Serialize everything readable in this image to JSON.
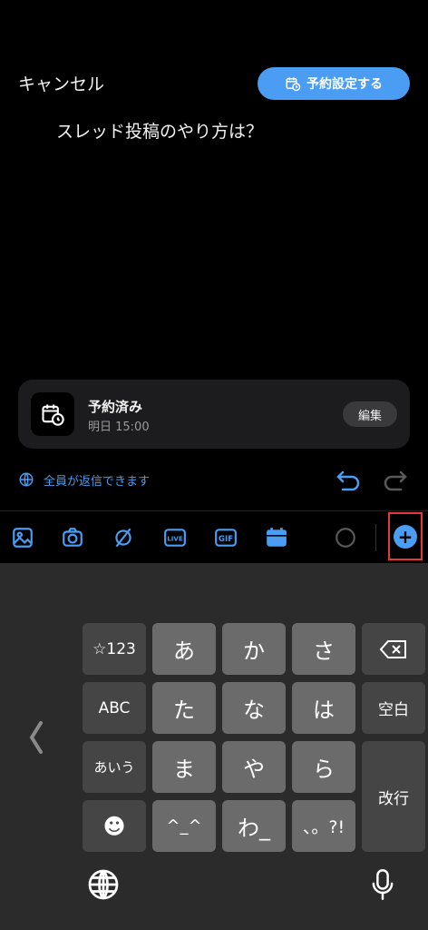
{
  "header": {
    "cancel_label": "キャンセル",
    "schedule_button_label": "予約設定する"
  },
  "post": {
    "text": "スレッド投稿のやり方は？"
  },
  "schedule_card": {
    "title": "予約済み",
    "time": "明日 15:00",
    "edit_label": "編集"
  },
  "reply_setting": {
    "label": "全員が返信できます"
  },
  "toolbar": {
    "icons": [
      "image-icon",
      "camera-icon",
      "no-sign-icon",
      "live-icon",
      "gif-icon",
      "calendar-icon",
      "progress-ring-icon",
      "add-icon"
    ],
    "live_label": "LIVE",
    "gif_label": "GIF",
    "add_symbol": "+"
  },
  "keyboard": {
    "rows": [
      [
        "☆123",
        "あ",
        "か",
        "さ"
      ],
      [
        "ABC",
        "た",
        "な",
        "は",
        "空白"
      ],
      [
        "あいう",
        "ま",
        "や",
        "ら",
        "改行"
      ],
      [
        "☻",
        "^_^",
        "わ_",
        "、。?!"
      ]
    ]
  },
  "colors": {
    "accent": "#4a9df2",
    "background": "#000000",
    "keyboard_bg": "#2b2b2b",
    "highlight": "#e53935"
  }
}
